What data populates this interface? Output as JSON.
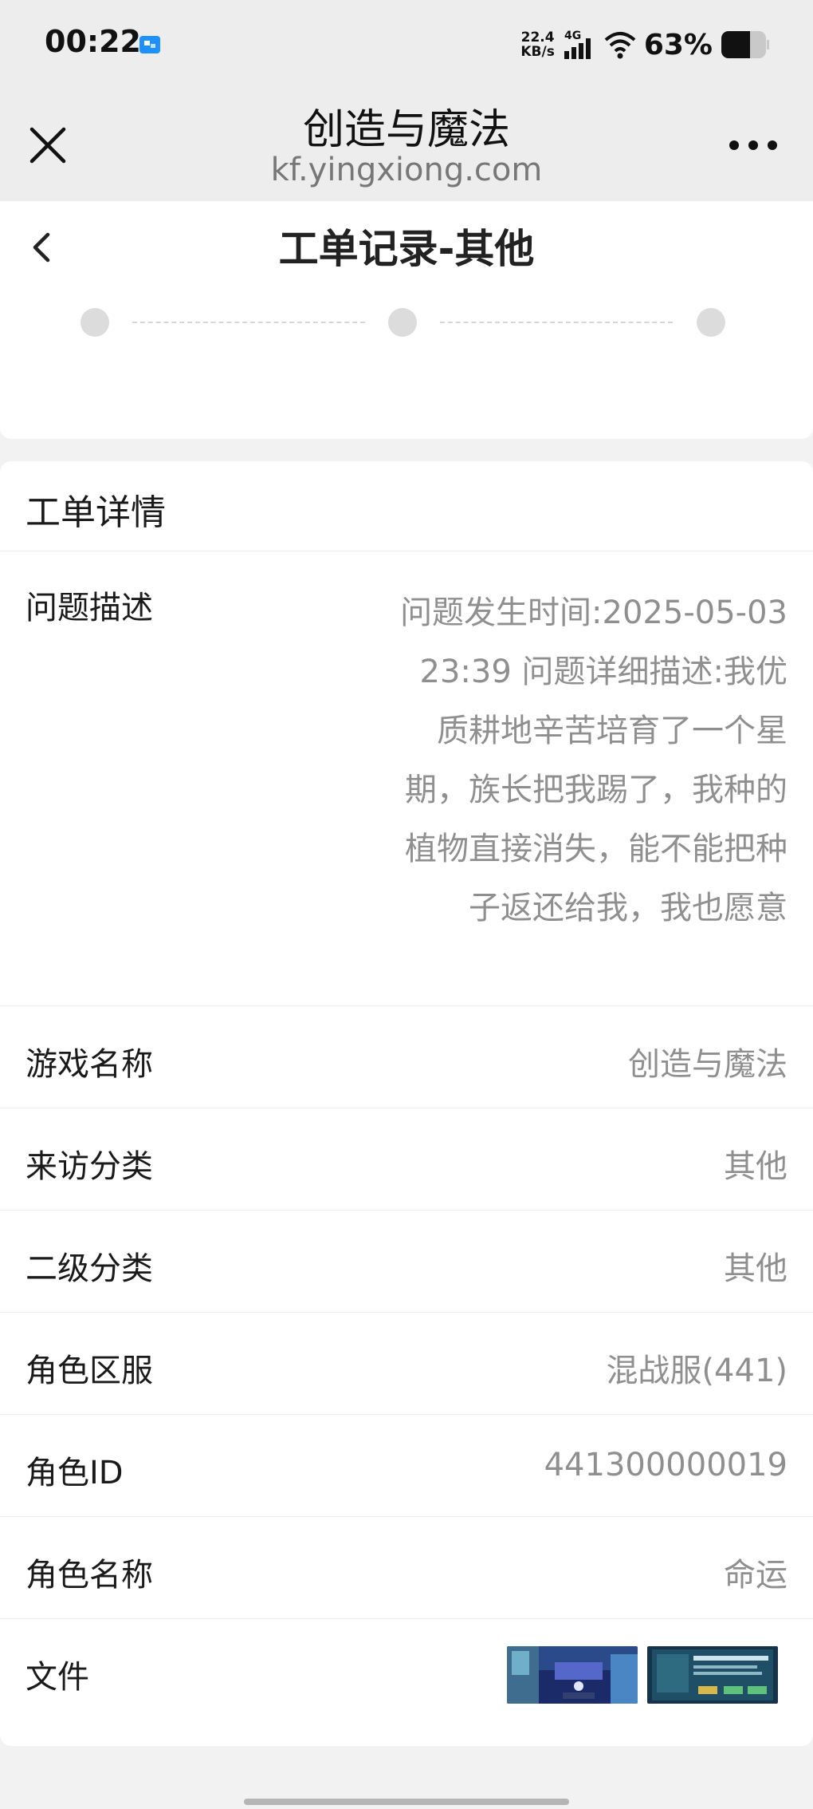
{
  "status_bar": {
    "time": "00:22",
    "net_speed_value": "22.4",
    "net_speed_unit": "KB/s",
    "network": "4G",
    "battery": "63%"
  },
  "browser": {
    "title": "创造与魔法",
    "url": "kf.yingxiong.com"
  },
  "page": {
    "title": "工单记录-其他"
  },
  "progress": {
    "steps": 3
  },
  "details": {
    "title": "工单详情",
    "description_label": "问题描述",
    "description_value": "问题发生时间:2025-05-03 23:39 问题详细描述:我优质耕地辛苦培育了一个星期，族长把我踢了，我种的植物直接消失，能不能把种子返还给我，我也愿意",
    "rows": [
      {
        "label": "游戏名称",
        "value": "创造与魔法"
      },
      {
        "label": "来访分类",
        "value": "其他"
      },
      {
        "label": "二级分类",
        "value": "其他"
      },
      {
        "label": "角色区服",
        "value": "混战服(441)"
      },
      {
        "label": "角色ID",
        "value": "441300000019"
      },
      {
        "label": "角色名称",
        "value": "命运"
      }
    ],
    "files_label": "文件"
  }
}
